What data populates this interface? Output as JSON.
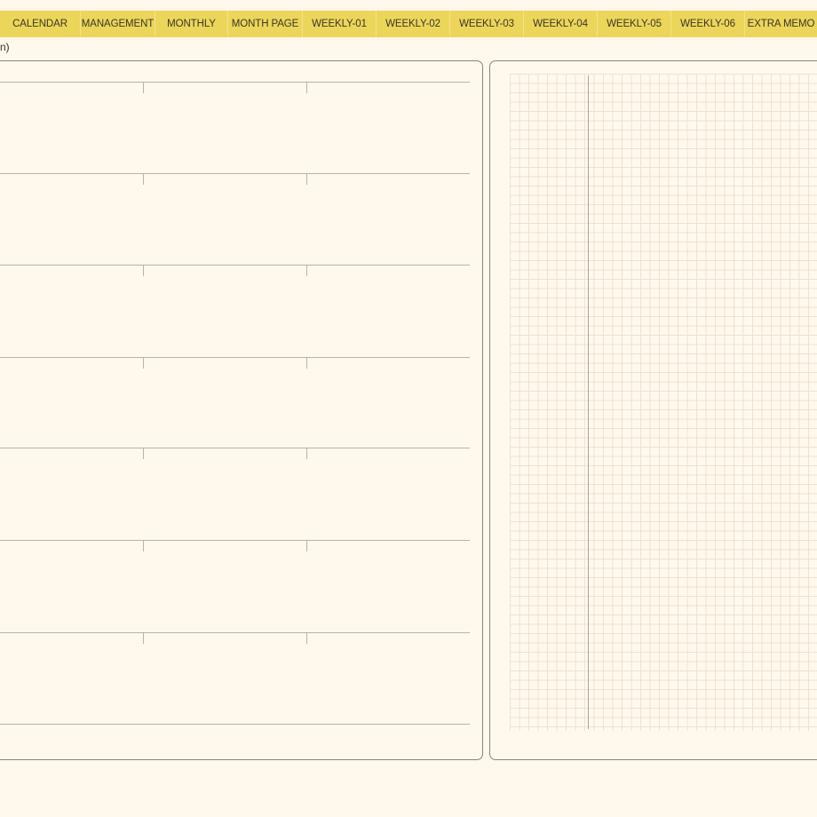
{
  "tabs": [
    {
      "label": "CALENDAR"
    },
    {
      "label": "MANAGEMENT"
    },
    {
      "label": "MONTHLY"
    },
    {
      "label": "MONTH PAGE"
    },
    {
      "label": "WEEKLY-01"
    },
    {
      "label": "WEEKLY-02"
    },
    {
      "label": "WEEKLY-03"
    },
    {
      "label": "WEEKLY-04"
    },
    {
      "label": "WEEKLY-05"
    },
    {
      "label": "WEEKLY-06"
    },
    {
      "label": "EXTRA MEMO"
    }
  ],
  "breadcrumb": "n)",
  "colors": {
    "tab_bar": "#ecd65a",
    "page_background": "#fff8ed",
    "panel_border": "#8a8577",
    "rule_line": "#b9b3a6",
    "grid_line": "#ece2d3"
  }
}
